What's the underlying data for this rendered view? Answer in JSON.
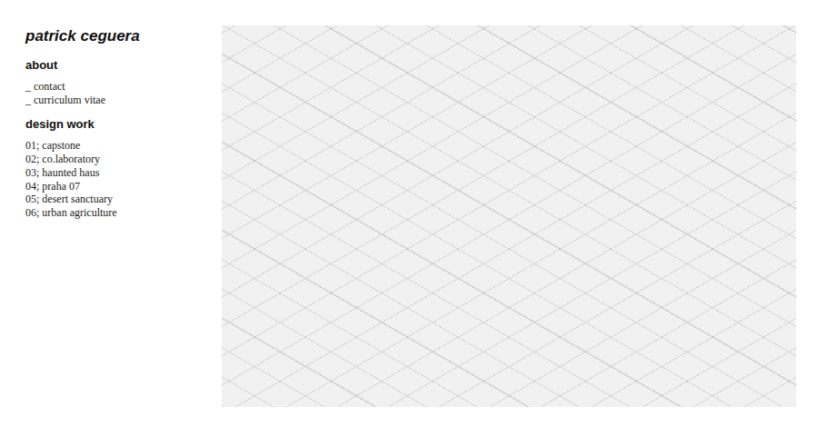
{
  "site": {
    "title": "patrick ceguera"
  },
  "sections": [
    {
      "heading": "about",
      "links": [
        "_ contact",
        "_ curriculum vitae"
      ]
    },
    {
      "heading": "design work",
      "links": [
        "01; capstone",
        "02; co.laboratory",
        "03; haunted haus",
        "04; praha 07",
        "05; desert sanctuary",
        "06; urban agriculture"
      ]
    }
  ]
}
